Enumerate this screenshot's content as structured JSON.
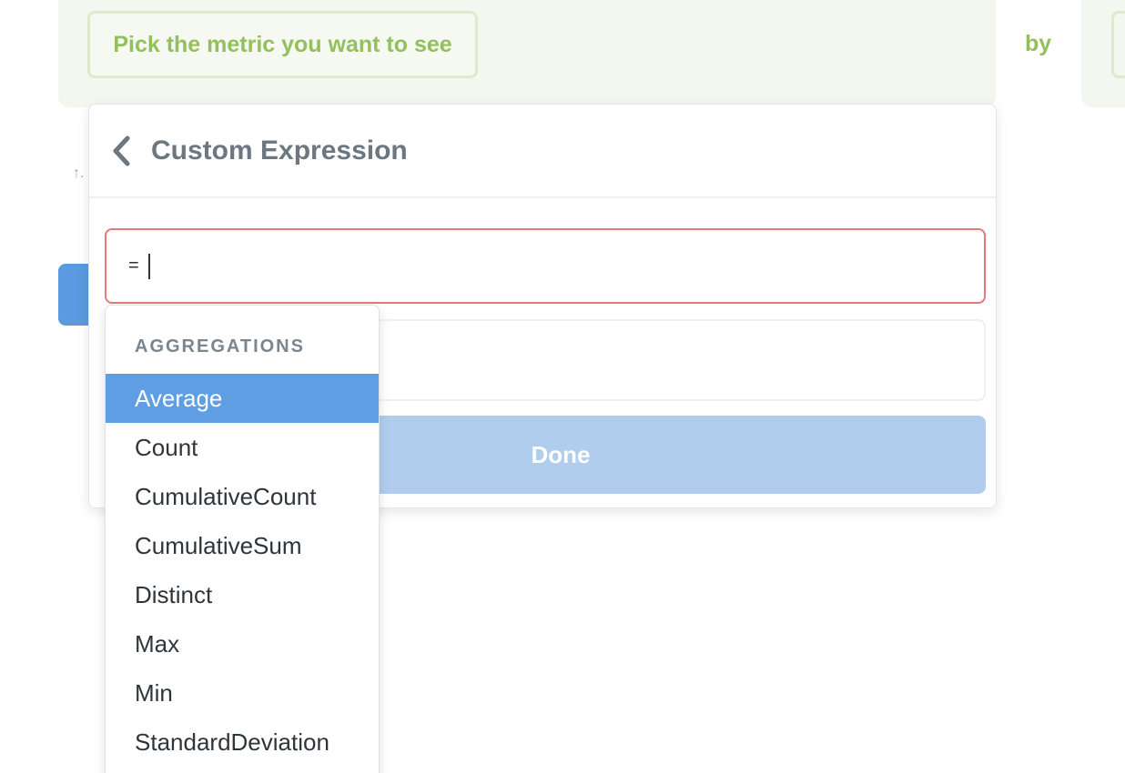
{
  "query_builder": {
    "metric_placeholder": "Pick the metric you want to see",
    "by_label": "by",
    "sort_icon": "sort-ascending-icon"
  },
  "popover": {
    "title": "Custom Expression",
    "back_icon": "chevron-left-icon",
    "expression_value": "= ",
    "name_placeholder": "",
    "done_label": "Done"
  },
  "suggestions": {
    "section_header": "AGGREGATIONS",
    "selected_index": 0,
    "items": [
      {
        "label": "Average"
      },
      {
        "label": "Count"
      },
      {
        "label": "CumulativeCount"
      },
      {
        "label": "CumulativeSum"
      },
      {
        "label": "Distinct"
      },
      {
        "label": "Max"
      },
      {
        "label": "Min"
      },
      {
        "label": "StandardDeviation"
      }
    ]
  },
  "colors": {
    "accent_green": "#94bf5d",
    "accent_blue": "#5f9ee3",
    "done_disabled": "#b1cdee",
    "error_border": "#e47a7a"
  }
}
